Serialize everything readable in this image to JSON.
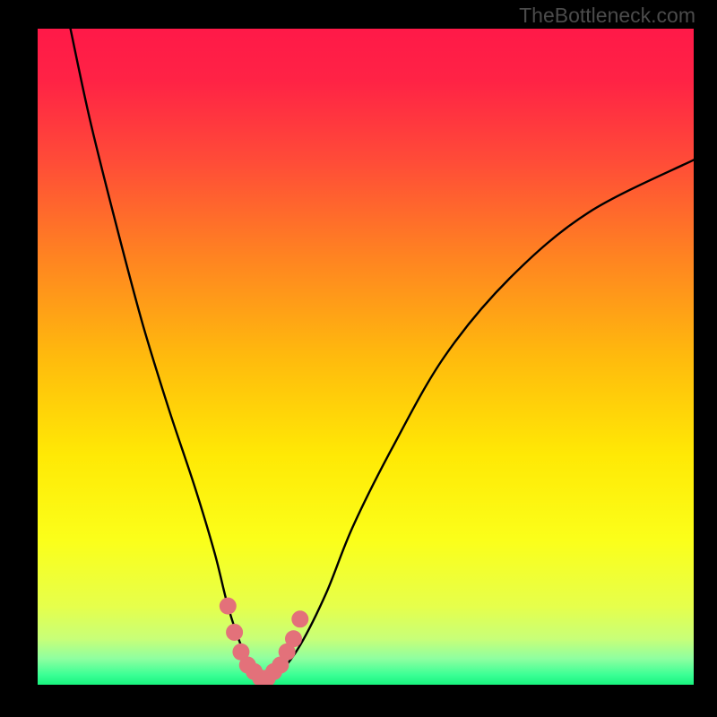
{
  "watermark": {
    "text": "TheBottleneck.com"
  },
  "colors": {
    "frame_bg": "#000000",
    "gradient_stops": [
      {
        "offset": 0.0,
        "color": "#ff1948"
      },
      {
        "offset": 0.08,
        "color": "#ff2345"
      },
      {
        "offset": 0.2,
        "color": "#ff4b38"
      },
      {
        "offset": 0.35,
        "color": "#ff8421"
      },
      {
        "offset": 0.5,
        "color": "#ffba0d"
      },
      {
        "offset": 0.65,
        "color": "#ffe905"
      },
      {
        "offset": 0.78,
        "color": "#fbff1a"
      },
      {
        "offset": 0.88,
        "color": "#e6ff4b"
      },
      {
        "offset": 0.93,
        "color": "#c8ff78"
      },
      {
        "offset": 0.96,
        "color": "#8fffa0"
      },
      {
        "offset": 0.985,
        "color": "#3bff95"
      },
      {
        "offset": 1.0,
        "color": "#18f47e"
      }
    ],
    "curve": "#000000",
    "marker_fill": "#e3717a",
    "marker_stroke": "#c75a63"
  },
  "chart_data": {
    "type": "line",
    "title": "",
    "xlabel": "",
    "ylabel": "",
    "xlim": [
      0,
      100
    ],
    "ylim": [
      0,
      100
    ],
    "series": [
      {
        "name": "bottleneck-curve",
        "x": [
          5,
          8,
          12,
          16,
          20,
          24,
          27,
          29,
          31,
          33,
          35,
          37,
          40,
          44,
          48,
          54,
          62,
          72,
          84,
          100
        ],
        "y": [
          100,
          86,
          70,
          55,
          42,
          30,
          20,
          12,
          6,
          2,
          1,
          2,
          6,
          14,
          24,
          36,
          50,
          62,
          72,
          80
        ]
      }
    ],
    "markers": {
      "name": "highlighted-range",
      "x": [
        29,
        30,
        31,
        32,
        33,
        34,
        35,
        36,
        37,
        38,
        39,
        40
      ],
      "y": [
        12,
        8,
        5,
        3,
        2,
        1,
        1,
        2,
        3,
        5,
        7,
        10
      ]
    }
  }
}
